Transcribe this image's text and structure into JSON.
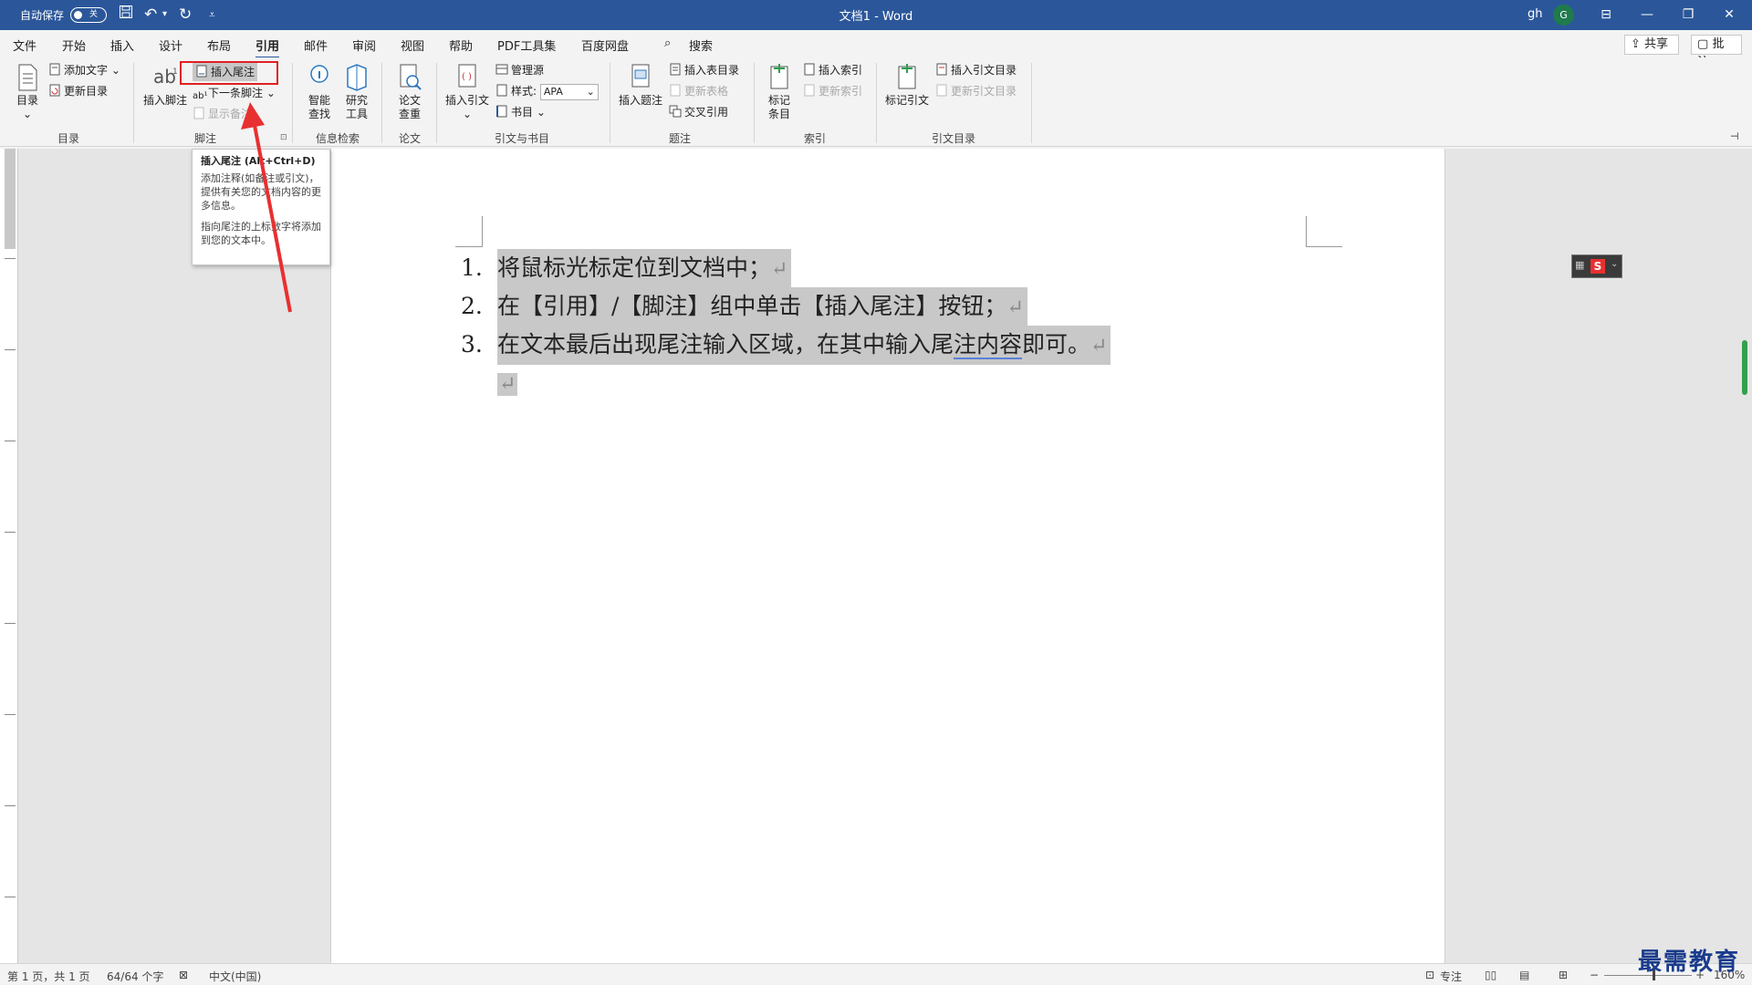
{
  "titlebar": {
    "autosave_label": "自动保存",
    "autosave_state": "关",
    "doc_title": "文档1  -  Word",
    "user": "gh",
    "avatar_letter": "G"
  },
  "menu": {
    "items": [
      "文件",
      "开始",
      "插入",
      "设计",
      "布局",
      "引用",
      "邮件",
      "审阅",
      "视图",
      "帮助",
      "PDF工具集",
      "百度网盘"
    ],
    "active": "引用",
    "search": "搜索",
    "share": "共享",
    "comment": "批注"
  },
  "ribbon": {
    "toc": {
      "big": "目录",
      "add_text": "添加文字",
      "update": "更新目录",
      "group": "目录"
    },
    "footnotes": {
      "insert_footnote": "插入脚注",
      "insert_endnote": "插入尾注",
      "next_footnote": "下一条脚注",
      "show_notes": "显示备注",
      "group": "脚注"
    },
    "research": {
      "smart_lookup": "智能查找",
      "researcher": "研究工具",
      "group": "信息检索"
    },
    "paper": {
      "check": "论文查重",
      "group": "论文"
    },
    "citations": {
      "insert_citation": "插入引文",
      "manage_sources": "管理源",
      "style_label": "样式:",
      "style_value": "APA",
      "bibliography": "书目",
      "group": "引文与书目"
    },
    "captions": {
      "insert_caption": "插入题注",
      "insert_table_figures": "插入表目录",
      "update_table": "更新表格",
      "cross_reference": "交叉引用",
      "group": "题注"
    },
    "index": {
      "mark_entry": "标记条目",
      "insert_index": "插入索引",
      "update_index": "更新索引",
      "group": "索引"
    },
    "authorities": {
      "mark_citation": "标记引文",
      "insert_toa": "插入引文目录",
      "update_toa": "更新引文目录",
      "group": "引文目录"
    }
  },
  "tooltip": {
    "title": "插入尾注 (Alt+Ctrl+D)",
    "body1": "添加注释(如备注或引文)，提供有关您的文档内容的更多信息。",
    "body2": "指向尾注的上标数字将添加到您的文本中。"
  },
  "document": {
    "items": [
      {
        "num": "1.",
        "text": "将鼠标光标定位到文档中；"
      },
      {
        "num": "2.",
        "text": "在【引用】/【脚注】组中单击【插入尾注】按钮；"
      },
      {
        "num": "3.",
        "text_before": "在文本最后出现尾注输入区域，在其中输入尾",
        "text_squiggle": "注内容",
        "text_after": "即可。"
      }
    ],
    "pilcrow": "↵"
  },
  "status": {
    "page": "第 1 页，共 1 页",
    "words": "64/64 个字",
    "language": "中文(中国)",
    "focus": "专注",
    "zoom": "160%"
  },
  "watermark": "最需教育",
  "colors": {
    "titlebar": "#2b579a",
    "highlight_box": "#e02020",
    "selection": "#c8c8c8"
  }
}
